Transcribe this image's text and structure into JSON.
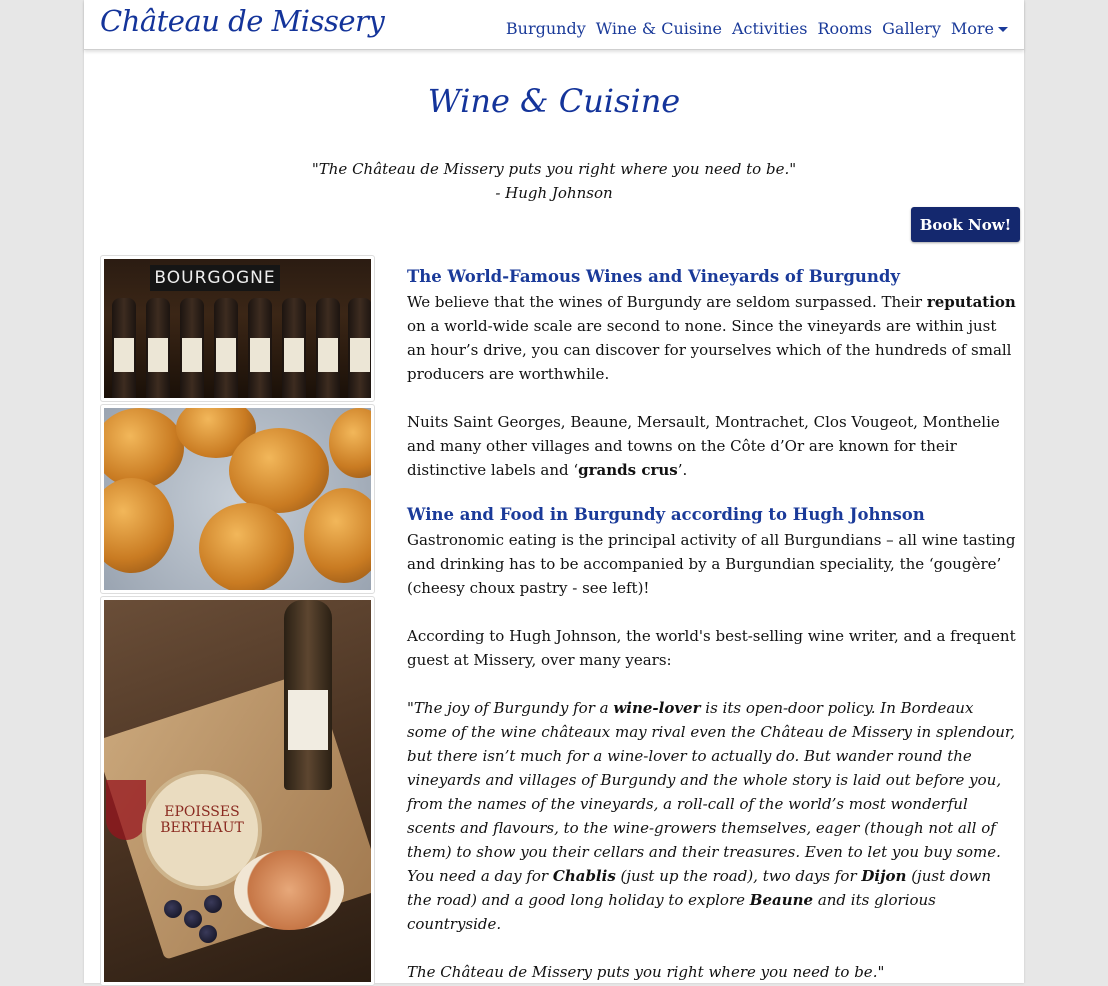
{
  "brand": "Château de Missery",
  "nav": {
    "items": [
      "Burgundy",
      "Wine & Cuisine",
      "Activities",
      "Rooms",
      "Gallery"
    ],
    "more_label": "More"
  },
  "page_title": "Wine & Cuisine",
  "top_quote": {
    "text": "\"The Château de Missery puts you right where you need to be.\"",
    "author": "- Hugh Johnson"
  },
  "book_button": "Book Now!",
  "images": {
    "wine_sign": "BOURGOGNE",
    "cheese_label": "EPOISSES BERTHAUT"
  },
  "section1": {
    "heading": "The World-Famous Wines and Vineyards of Burgundy",
    "p1_a": "We believe that the wines of Burgundy are seldom surpassed. Their ",
    "p1_b": "reputation",
    "p1_c": " on a world-wide scale are second to none. Since the vineyards are within just an hour’s drive, you can discover for yourselves which of the hundreds of small producers are worthwhile.",
    "p2_a": "Nuits Saint Georges, Beaune, Mersault, Montrachet, Clos Vougeot, Monthelie and many other villages and towns on the Côte d’Or are known for their distinctive labels and ‘",
    "p2_b": "grands crus",
    "p2_c": "’."
  },
  "section2": {
    "heading": "Wine and Food in Burgundy according to Hugh Johnson",
    "p1": "Gastronomic eating is the principal activity of all Burgundians – all wine tasting and drinking has to be accompanied by a Burgundian speciality, the ‘gougère’ (cheesy choux pastry - see left)!",
    "p2": "According to Hugh Johnson, the world's best-selling wine writer, and a frequent guest at Missery, over many years:",
    "q_a": "\"The joy of Burgundy for a ",
    "q_b": "wine-lover",
    "q_c": " is its open-door policy. In Bordeaux some of the wine châteaux may rival even the Château de Missery in splendour, but there isn’t much for a wine-lover to actually do. But wander round the vineyards and villages of Burgundy and the whole story is laid out before you, from the names of the vineyards, a roll-call of the world’s most wonderful scents and flavours, to the wine-growers themselves, eager (though not all of them) to show you their cellars and their treasures. Even to let you buy some. You need a day for ",
    "q_d": "Chablis",
    "q_e": " (just up the road), two days for ",
    "q_f": "Dijon",
    "q_g": " (just down the road) and a good long holiday to explore ",
    "q_h": "Beaune",
    "q_i": " and its glorious countryside.",
    "q_end": "The Château de Missery puts you right where you need to be.\""
  },
  "colors": {
    "brand_blue": "#14349a",
    "button_navy": "#14286e"
  }
}
